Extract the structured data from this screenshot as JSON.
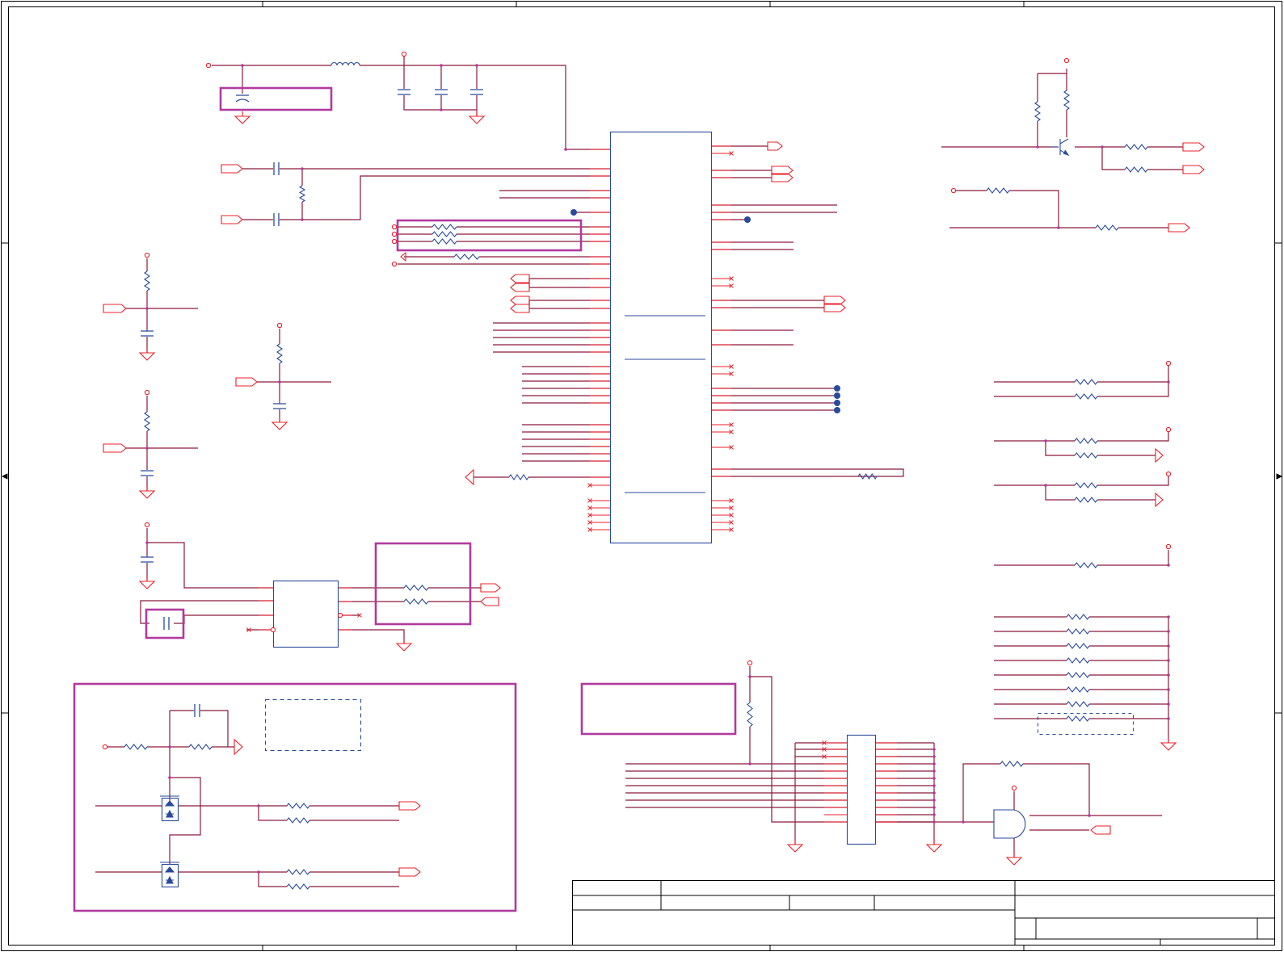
{
  "colors": {
    "background": "#ffffff",
    "frame": "#000000",
    "wire": "#8b1a3a",
    "pin": "#e8202a",
    "component": "#2a4a9a",
    "highlight": "#b03a9e",
    "junction": "#2a4a9a"
  },
  "icons": {
    "frame": "drawing-frame",
    "title-block": "title-block-table",
    "ic": "ic-rectangle-symbol",
    "resistor": "resistor-zigzag-symbol",
    "capacitor": "capacitor-symbol",
    "inductor": "inductor-coil-symbol",
    "ground": "ground-triangle-symbol",
    "port": "offpage-port-symbol",
    "power": "power-pin-circle",
    "transistor": "transistor-symbol",
    "mosfet": "mosfet-symbol",
    "and-gate": "and-gate-symbol",
    "no-connect": "no-connect-x-symbol",
    "junction": "junction-dot",
    "highlight": "highlight-box"
  }
}
